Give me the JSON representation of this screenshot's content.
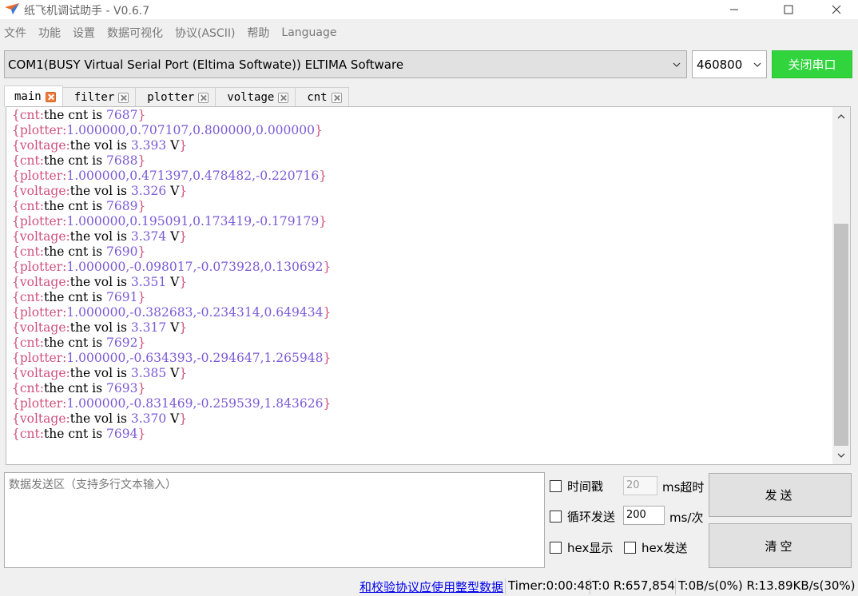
{
  "window": {
    "title": "纸飞机调试助手 - V0.6.7"
  },
  "menu": [
    "文件",
    "功能",
    "设置",
    "数据可视化",
    "协议(ASCII)",
    "帮助",
    "Language"
  ],
  "port": {
    "selected": "COM1(BUSY  Virtual Serial Port (Eltima Softwate)) ELTIMA Software",
    "baud": "460800",
    "close_label": "关闭串口"
  },
  "tabs": [
    {
      "label": "main",
      "active": true
    },
    {
      "label": "filter",
      "active": false
    },
    {
      "label": "plotter",
      "active": false
    },
    {
      "label": "voltage",
      "active": false
    },
    {
      "label": "cnt",
      "active": false
    }
  ],
  "log": [
    {
      "key": "cnt",
      "text": "the cnt is ",
      "values": "7687",
      "suffix": ""
    },
    {
      "key": "plotter",
      "text": "",
      "values": "1.000000,0.707107,0.800000,0.000000",
      "suffix": ""
    },
    {
      "key": "voltage",
      "text": "the vol is ",
      "values": "3.393",
      "suffix": " V"
    },
    {
      "key": "cnt",
      "text": "the cnt is ",
      "values": "7688",
      "suffix": ""
    },
    {
      "key": "plotter",
      "text": "",
      "values": "1.000000,0.471397,0.478482,-0.220716",
      "suffix": ""
    },
    {
      "key": "voltage",
      "text": "the vol is ",
      "values": "3.326",
      "suffix": " V"
    },
    {
      "key": "cnt",
      "text": "the cnt is ",
      "values": "7689",
      "suffix": ""
    },
    {
      "key": "plotter",
      "text": "",
      "values": "1.000000,0.195091,0.173419,-0.179179",
      "suffix": ""
    },
    {
      "key": "voltage",
      "text": "the vol is ",
      "values": "3.374",
      "suffix": " V"
    },
    {
      "key": "cnt",
      "text": "the cnt is ",
      "values": "7690",
      "suffix": ""
    },
    {
      "key": "plotter",
      "text": "",
      "values": "1.000000,-0.098017,-0.073928,0.130692",
      "suffix": ""
    },
    {
      "key": "voltage",
      "text": "the vol is ",
      "values": "3.351",
      "suffix": " V"
    },
    {
      "key": "cnt",
      "text": "the cnt is ",
      "values": "7691",
      "suffix": ""
    },
    {
      "key": "plotter",
      "text": "",
      "values": "1.000000,-0.382683,-0.234314,0.649434",
      "suffix": ""
    },
    {
      "key": "voltage",
      "text": "the vol is ",
      "values": "3.317",
      "suffix": " V"
    },
    {
      "key": "cnt",
      "text": "the cnt is ",
      "values": "7692",
      "suffix": ""
    },
    {
      "key": "plotter",
      "text": "",
      "values": "1.000000,-0.634393,-0.294647,1.265948",
      "suffix": ""
    },
    {
      "key": "voltage",
      "text": "the vol is ",
      "values": "3.385",
      "suffix": " V"
    },
    {
      "key": "cnt",
      "text": "the cnt is ",
      "values": "7693",
      "suffix": ""
    },
    {
      "key": "plotter",
      "text": "",
      "values": "1.000000,-0.831469,-0.259539,1.843626",
      "suffix": ""
    },
    {
      "key": "voltage",
      "text": "the vol is ",
      "values": "3.370",
      "suffix": " V"
    },
    {
      "key": "cnt",
      "text": "the cnt is ",
      "values": "7694",
      "suffix": ""
    }
  ],
  "send": {
    "placeholder": "数据发送区（支持多行文本输入）",
    "timestamp_label": "时间戳",
    "timeout_value": "20",
    "timeout_unit": "ms超时",
    "loop_label": "循环发送",
    "interval_value": "200",
    "interval_unit": "ms/次",
    "hex_display_label": "hex显示",
    "hex_send_label": "hex发送",
    "send_button": "发送",
    "clear_button": "清空"
  },
  "status": {
    "link": "和校验协议应使用整型数据",
    "timer": "Timer:0:00:48",
    "counts": "T:0 R:657,854",
    "rates": "T:0B/s(0%) R:13.89KB/s(30%)"
  },
  "colors": {
    "bracket": "#d0507a",
    "number": "#7b5bd6",
    "close_port_bg": "#31d43d",
    "active_tab_close": "#ee7a3a",
    "link": "#0000ee"
  },
  "icons": {
    "app": "paper-plane-icon",
    "minimize": "minimize-icon",
    "maximize": "maximize-icon",
    "close": "close-icon"
  }
}
